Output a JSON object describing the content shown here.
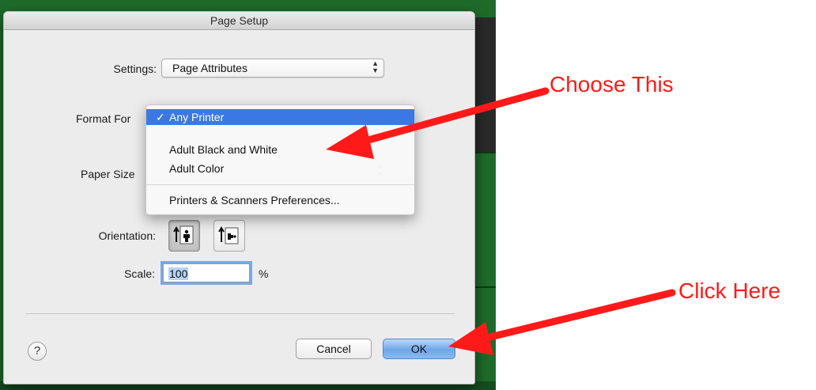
{
  "dialog": {
    "title": "Page Setup",
    "settings": {
      "label": "Settings:",
      "value": "Page Attributes"
    },
    "format_for": {
      "label": "Format For"
    },
    "paper_size": {
      "label": "Paper Size"
    },
    "orientation": {
      "label": "Orientation:",
      "options": [
        "portrait-icon",
        "landscape-icon"
      ],
      "selected": "portrait"
    },
    "scale": {
      "label": "Scale:",
      "value": "100",
      "unit": "%"
    },
    "buttons": {
      "help": "?",
      "cancel": "Cancel",
      "ok": "OK"
    }
  },
  "menu": {
    "items": [
      {
        "label": "Any Printer",
        "checked": true
      },
      {
        "label": "Adult Black and White"
      },
      {
        "label": "Adult Color"
      },
      {
        "label": "Printers & Scanners Preferences..."
      }
    ]
  },
  "annotations": {
    "choose": "Choose This",
    "click": "Click Here",
    "color": "#ff1a1a"
  },
  "colors": {
    "desktop": "#1f6b2a",
    "menu_highlight": "#3b78e3",
    "ok_button": "#6ea6e8",
    "focus_ring": "#79a8e6"
  }
}
